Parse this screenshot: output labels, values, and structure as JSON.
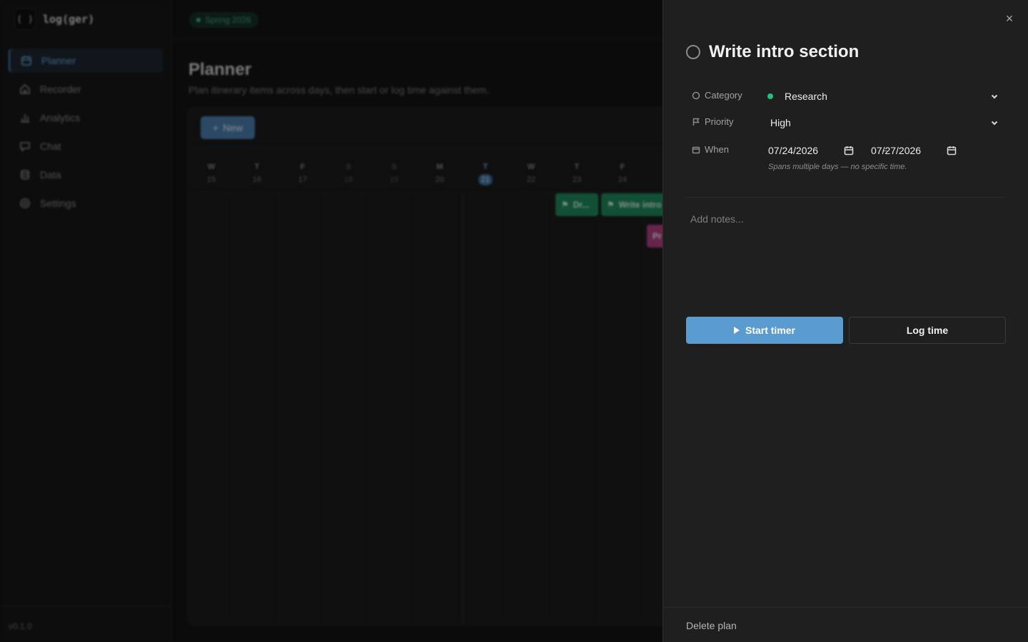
{
  "app": {
    "logo_glyph": "( )",
    "name": "log(ger)",
    "version": "v0.1.0"
  },
  "sidebar": {
    "items": [
      {
        "label": "Planner",
        "icon": "calendar-icon",
        "active": true
      },
      {
        "label": "Recorder",
        "icon": "home-icon",
        "active": false
      },
      {
        "label": "Analytics",
        "icon": "bar-chart-icon",
        "active": false
      },
      {
        "label": "Chat",
        "icon": "chat-bubble-icon",
        "active": false
      },
      {
        "label": "Data",
        "icon": "database-icon",
        "active": false
      },
      {
        "label": "Settings",
        "icon": "gear-icon",
        "active": false
      }
    ]
  },
  "main": {
    "semester": "Spring 2026",
    "title": "Planner",
    "subtitle": "Plan itinerary items across days, then start or log time against them.",
    "new_button": "New",
    "days": [
      {
        "letter": "W",
        "num": "15"
      },
      {
        "letter": "T",
        "num": "16"
      },
      {
        "letter": "F",
        "num": "17"
      },
      {
        "letter": "S",
        "num": "18",
        "weekend": true
      },
      {
        "letter": "S",
        "num": "19",
        "weekend": true
      },
      {
        "letter": "M",
        "num": "20"
      },
      {
        "letter": "T",
        "num": "21",
        "today": true
      },
      {
        "letter": "W",
        "num": "22"
      },
      {
        "letter": "T",
        "num": "23"
      },
      {
        "letter": "F",
        "num": "24"
      }
    ],
    "events": [
      {
        "label": "Dr...",
        "color": "green"
      },
      {
        "label": "Write intro",
        "color": "green"
      },
      {
        "label": "Pr",
        "color": "pink"
      }
    ]
  },
  "drawer": {
    "title": "Write intro section",
    "category_label": "Category",
    "category_value": "Research",
    "category_color": "#22c07a",
    "priority_label": "Priority",
    "priority_value": "High",
    "when_label": "When",
    "start_date": "07/24/2026",
    "end_date": "07/27/2026",
    "date_separator": "–",
    "when_hint": "Spans multiple days — no specific time.",
    "notes_placeholder": "Add notes...",
    "start_timer": "Start timer",
    "log_time": "Log time",
    "delete": "Delete plan",
    "close_glyph": "×"
  },
  "colors": {
    "accent": "#5a9bd0",
    "research_green": "#22c07a",
    "event_green": "#1e8a5c",
    "event_pink": "#b03f80"
  }
}
